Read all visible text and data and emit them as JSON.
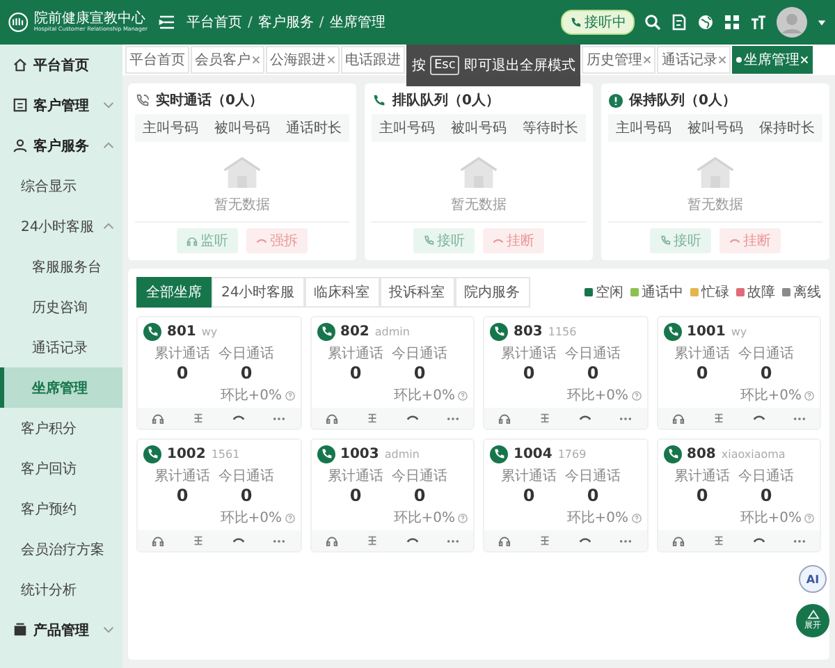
{
  "header": {
    "logo_title": "院前健康宣教中心",
    "logo_subtitle": "Hospital Customer Relationship Manager",
    "breadcrumb": [
      "平台首页",
      "客户服务",
      "坐席管理"
    ],
    "breadcrumb_separator": "/",
    "status": "接听中"
  },
  "sidebar": {
    "items": [
      {
        "label": "平台首页",
        "selected": false
      },
      {
        "label": "客户管理",
        "selected": false,
        "expanded": false
      },
      {
        "label": "客户服务",
        "selected": false,
        "expanded": true,
        "children": [
          {
            "label": "综合显示",
            "selected": false
          },
          {
            "label": "24小时客服",
            "selected": false,
            "expanded": true,
            "children": [
              {
                "label": "客服服务台",
                "selected": false
              },
              {
                "label": "历史咨询",
                "selected": false
              },
              {
                "label": "通话记录",
                "selected": false
              },
              {
                "label": "坐席管理",
                "selected": true
              }
            ]
          },
          {
            "label": "客户积分",
            "selected": false
          },
          {
            "label": "客户回访",
            "selected": false
          },
          {
            "label": "客户预约",
            "selected": false
          },
          {
            "label": "会员治疗方案",
            "selected": false
          },
          {
            "label": "统计分析",
            "selected": false
          }
        ]
      },
      {
        "label": "产品管理",
        "selected": false,
        "expanded": false
      }
    ]
  },
  "tabs": [
    {
      "label": "平台首页",
      "closable": false,
      "selected": false
    },
    {
      "label": "会员客户",
      "closable": true,
      "selected": false
    },
    {
      "label": "公海跟进",
      "closable": true,
      "selected": false
    },
    {
      "label": "电话跟进",
      "closable": false,
      "selected": false
    },
    {
      "label": "历史管理",
      "closable": true,
      "selected": false
    },
    {
      "label": "通话记录",
      "closable": true,
      "selected": false
    },
    {
      "label": "坐席管理",
      "closable": true,
      "selected": true
    }
  ],
  "fullscreen_hint": {
    "before": "按",
    "key": "Esc",
    "after": "即可退出全屏模式"
  },
  "queues": [
    {
      "kind": "live",
      "title": "实时通话（0人）",
      "columns": [
        "主叫号码",
        "被叫号码",
        "通话时长"
      ],
      "empty_text": "暂无数据",
      "buttons": [
        {
          "label": "监听",
          "kind": "listen",
          "disabled": true
        },
        {
          "label": "强拆",
          "kind": "cut",
          "disabled": true
        }
      ]
    },
    {
      "kind": "waiting",
      "title": "排队队列（0人）",
      "columns": [
        "主叫号码",
        "被叫号码",
        "等待时长"
      ],
      "empty_text": "暂无数据",
      "buttons": [
        {
          "label": "接听",
          "kind": "answer",
          "disabled": true
        },
        {
          "label": "挂断",
          "kind": "hangup",
          "disabled": true
        }
      ]
    },
    {
      "kind": "hold",
      "title": "保持队列（0人）",
      "columns": [
        "主叫号码",
        "被叫号码",
        "保持时长"
      ],
      "empty_text": "暂无数据",
      "buttons": [
        {
          "label": "接听",
          "kind": "answer",
          "disabled": true
        },
        {
          "label": "挂断",
          "kind": "hangup",
          "disabled": true
        }
      ]
    }
  ],
  "agent_tabs": [
    {
      "label": "全部坐席",
      "selected": true
    },
    {
      "label": "24小时客服",
      "selected": false
    },
    {
      "label": "临床科室",
      "selected": false
    },
    {
      "label": "投诉科室",
      "selected": false
    },
    {
      "label": "院内服务",
      "selected": false
    }
  ],
  "legend": [
    {
      "label": "空闲",
      "color": "#17754c"
    },
    {
      "label": "通话中",
      "color": "#8cc152"
    },
    {
      "label": "忙碌",
      "color": "#e2b64d"
    },
    {
      "label": "故障",
      "color": "#e06c75"
    },
    {
      "label": "离线",
      "color": "#8a8a8a"
    }
  ],
  "agents": [
    {
      "ext": "801",
      "user": "wy",
      "color": "#17754c",
      "total_label": "累计通话",
      "total": "0",
      "today_label": "今日通话",
      "today": "0",
      "ratio": "环比+0%"
    },
    {
      "ext": "802",
      "user": "admin",
      "color": "#17754c",
      "total_label": "累计通话",
      "total": "0",
      "today_label": "今日通话",
      "today": "0",
      "ratio": "环比+0%"
    },
    {
      "ext": "803",
      "user": "1156",
      "color": "#17754c",
      "total_label": "累计通话",
      "total": "0",
      "today_label": "今日通话",
      "today": "0",
      "ratio": "环比+0%"
    },
    {
      "ext": "1001",
      "user": "wy",
      "color": "#17754c",
      "total_label": "累计通话",
      "total": "0",
      "today_label": "今日通话",
      "today": "0",
      "ratio": "环比+0%"
    },
    {
      "ext": "1002",
      "user": "1561",
      "color": "#17754c",
      "total_label": "累计通话",
      "total": "0",
      "today_label": "今日通话",
      "today": "0",
      "ratio": "环比+0%"
    },
    {
      "ext": "1003",
      "user": "admin",
      "color": "#17754c",
      "total_label": "累计通话",
      "total": "0",
      "today_label": "今日通话",
      "today": "0",
      "ratio": "环比+0%"
    },
    {
      "ext": "1004",
      "user": "1769",
      "color": "#17754c",
      "total_label": "累计通话",
      "total": "0",
      "today_label": "今日通话",
      "today": "0",
      "ratio": "环比+0%"
    },
    {
      "ext": "808",
      "user": "xiaoxiaoma",
      "color": "#17754c",
      "total_label": "累计通话",
      "total": "0",
      "today_label": "今日通话",
      "today": "0",
      "ratio": "环比+0%"
    }
  ],
  "float_buttons": {
    "ai": "AI",
    "expand": "展开"
  }
}
